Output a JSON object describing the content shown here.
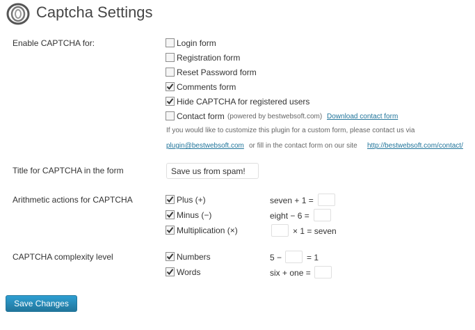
{
  "page": {
    "title": "Captcha Settings"
  },
  "colors": {
    "link": "#21759b",
    "button": "#21759b",
    "checkbox_check": "#333333"
  },
  "enable": {
    "label": "Enable CAPTCHA for:",
    "options": [
      {
        "label": "Login form",
        "checked": false
      },
      {
        "label": "Registration form",
        "checked": false
      },
      {
        "label": "Reset Password form",
        "checked": false
      },
      {
        "label": "Comments form",
        "checked": true
      },
      {
        "label": "Hide CAPTCHA for registered users",
        "checked": true
      },
      {
        "label": "Contact form",
        "checked": false
      }
    ],
    "powered_by": "(powered by bestwebsoft.com)",
    "download_link": "Download contact form",
    "note_line1": "If you would like to customize this plugin for a custom form, please contact us via",
    "note_email": "plugin@bestwebsoft.com",
    "note_middle": "or fill in the contact form on our site",
    "note_url": "http://bestwebsoft.com/contact/"
  },
  "title_field": {
    "label": "Title for CAPTCHA in the form",
    "value": "Save us from spam!"
  },
  "arithmetic": {
    "label": "Arithmetic actions for CAPTCHA",
    "options": [
      {
        "label": "Plus (+)",
        "checked": true
      },
      {
        "label": "Minus (−)",
        "checked": true
      },
      {
        "label": "Multiplication (×)",
        "checked": true
      }
    ],
    "examples": [
      {
        "left": "seven + 1 =",
        "right": ""
      },
      {
        "left": "eight − 6 =",
        "right": ""
      },
      {
        "left": "",
        "right": "× 1 = seven"
      }
    ]
  },
  "complexity": {
    "label": "CAPTCHA complexity level",
    "options": [
      {
        "label": "Numbers",
        "checked": true
      },
      {
        "label": "Words",
        "checked": true
      }
    ],
    "examples": [
      {
        "left": "5 −",
        "right": "= 1"
      },
      {
        "left": "six + one =",
        "right": ""
      }
    ]
  },
  "save_button": "Save Changes"
}
